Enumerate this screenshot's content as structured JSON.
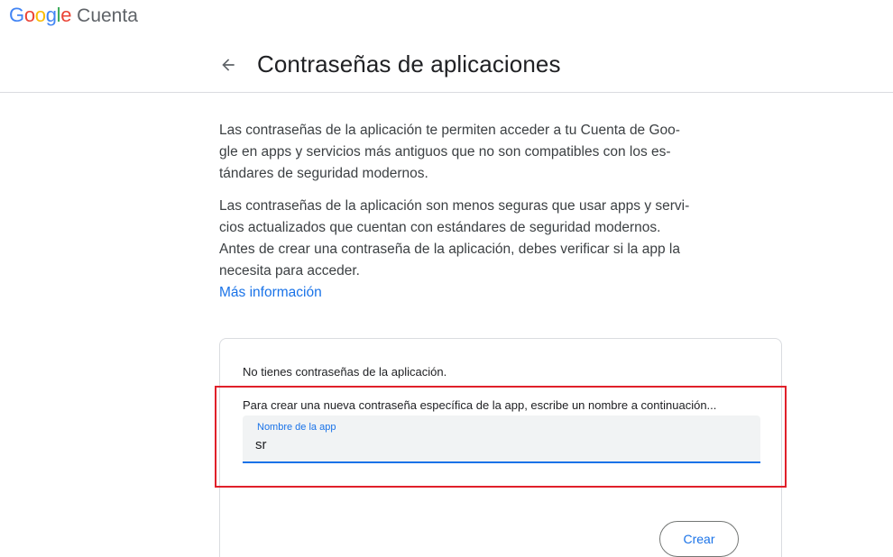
{
  "header": {
    "logo_letters": [
      "G",
      "o",
      "o",
      "g",
      "l",
      "e"
    ],
    "product_name": "Cuenta"
  },
  "page": {
    "title": "Contraseñas de aplicaciones",
    "back_icon": "arrow-back-icon"
  },
  "intro": {
    "paragraph_1": "Las contraseñas de la aplicación te permiten acceder a tu Cuenta de Goo-gle en apps y servicios más antiguos que no son compatibles con los es-tándares de seguridad modernos.",
    "paragraph_2": "Las contraseñas de la aplicación son menos seguras que usar apps y servi-cios actualizados que cuentan con estándares de seguridad modernos. Antes de crear una contraseña de la aplicación, debes verificar si la app la necesita para acceder.",
    "more_info_link": "Más información"
  },
  "card": {
    "no_passwords_text": "No tienes contraseñas de la aplicación.",
    "instructions": "Para crear una nueva contraseña específica de la app, escribe un nombre a continuación...",
    "app_name_field": {
      "label": "Nombre de la app",
      "value": "sr"
    },
    "create_button": "Crear"
  },
  "colors": {
    "accent": "#1a73e8",
    "highlight": "#e0202a",
    "divider": "#dadce0"
  }
}
